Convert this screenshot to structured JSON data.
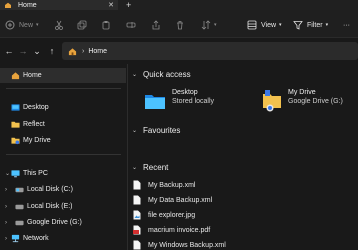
{
  "window": {
    "tab_title": "Home",
    "tab_close": "✕",
    "new_tab": "+"
  },
  "toolbar": {
    "new_label": "New",
    "new_caret": "▾",
    "view_label": "View",
    "view_caret": "▾",
    "filter_label": "Filter",
    "filter_caret": "▾",
    "more": "···"
  },
  "address": {
    "back": "←",
    "forward": "→",
    "recent": "⌄",
    "up": "↑",
    "separator": "›",
    "crumb": "Home"
  },
  "sidebar": {
    "items": [
      {
        "label": "Home",
        "icon": "home-icon",
        "selected": true
      },
      {
        "label": "Desktop",
        "icon": "desktop-icon"
      },
      {
        "label": "Reflect",
        "icon": "folder-icon"
      },
      {
        "label": "My Drive",
        "icon": "drive-icon"
      },
      {
        "label": "This PC",
        "icon": "pc-icon"
      },
      {
        "label": "Local Disk (C:)",
        "icon": "disk-icon"
      },
      {
        "label": "Local Disk (E:)",
        "icon": "disk-icon"
      },
      {
        "label": "Google Drive (G:)",
        "icon": "disk-icon"
      },
      {
        "label": "Network",
        "icon": "network-icon"
      }
    ]
  },
  "content": {
    "quick_access_title": "Quick access",
    "favourites_title": "Favourites",
    "recent_title": "Recent",
    "quick_access": [
      {
        "name": "Desktop",
        "sub": "Stored locally"
      },
      {
        "name": "My Drive",
        "sub": "Google Drive (G:)"
      }
    ],
    "recent": [
      {
        "name": "My Backup.xml",
        "icon": "file-icon"
      },
      {
        "name": "My  Data Backup.xml",
        "icon": "file-icon"
      },
      {
        "name": "file explorer.jpg",
        "icon": "image-icon"
      },
      {
        "name": "macrium invoice.pdf",
        "icon": "pdf-icon"
      },
      {
        "name": "My Windows  Backup.xml",
        "icon": "file-icon"
      }
    ]
  },
  "colors": {
    "background": "#191919",
    "accent": "#4cc2ff",
    "folder": "#f2c14e"
  }
}
